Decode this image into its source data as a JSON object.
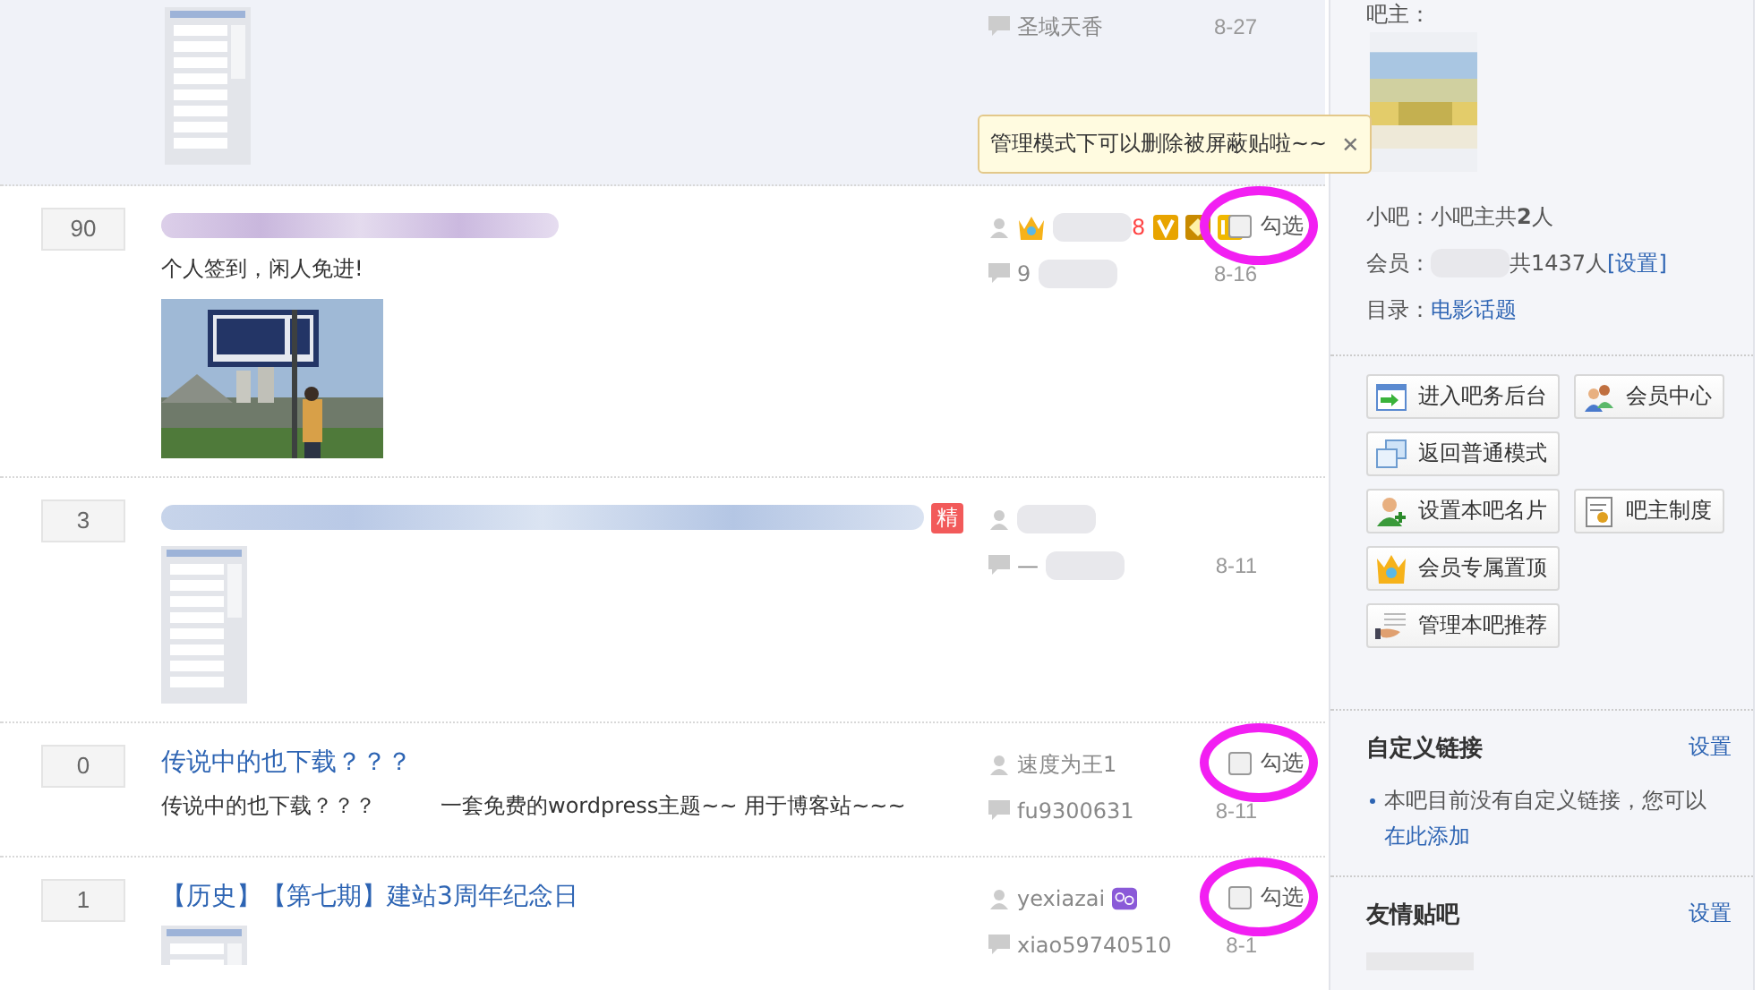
{
  "tooltip": {
    "text": "管理模式下可以删除被屏蔽贴啦~~",
    "close": "✕"
  },
  "threads": [
    {
      "shaded": true,
      "featured": false,
      "last_reply": {
        "kind": "text",
        "text": "圣域天香"
      },
      "date": "8-27"
    },
    {
      "shaded": false,
      "replies": "90",
      "title": {
        "kind": "blurred"
      },
      "featured": false,
      "excerpt": "个人签到，闲人免进!",
      "author": {
        "kind": "blurred",
        "text": "8",
        "vip": true
      },
      "last_reply": {
        "kind": "blurred",
        "text": "9"
      },
      "date": "8-16",
      "checkbox": {
        "label": "勾选",
        "checked": false,
        "circled": true
      }
    },
    {
      "shaded": false,
      "replies": "3",
      "title": {
        "kind": "blurred"
      },
      "featured": true,
      "featured_label": "精",
      "author": {
        "kind": "blurred",
        "vip": false
      },
      "last_reply": {
        "kind": "blurred",
        "text": "—"
      },
      "date": "8-11"
    },
    {
      "shaded": false,
      "replies": "0",
      "title": {
        "kind": "text",
        "text": "传说中的也下载？？？"
      },
      "featured": false,
      "excerpt": "传说中的也下载？？？　　　一套免费的wordpress主题~~ 用于博客站~~~",
      "author": {
        "kind": "text",
        "text": "速度为王1",
        "vip": false
      },
      "last_reply": {
        "kind": "text",
        "text": "fu9300631"
      },
      "date": "8-11",
      "checkbox": {
        "label": "勾选",
        "checked": false,
        "circled": true
      }
    },
    {
      "shaded": false,
      "replies": "1",
      "title": {
        "kind": "text",
        "text": "【历史】【第七期】建站3周年纪念日"
      },
      "featured": false,
      "author": {
        "kind": "text",
        "text": "yexiazai",
        "vip": false,
        "zodiac": true
      },
      "last_reply": {
        "kind": "text",
        "text": "xiao59740510"
      },
      "date": "8-1",
      "checkbox": {
        "label": "勾选",
        "checked": false,
        "circled": true
      }
    }
  ],
  "sidebar": {
    "owner_label": "吧主：",
    "info": [
      {
        "label": "小吧：",
        "value": "小吧主共**2**人",
        "kind": "plain"
      },
      {
        "label": "会员：",
        "value": "共1437人",
        "link": "[设置]",
        "kind": "members"
      },
      {
        "label": "目录：",
        "link": "电影话题",
        "kind": "link"
      }
    ],
    "buttons": [
      {
        "label": "进入吧务后台"
      },
      {
        "label": "会员中心"
      },
      {
        "label": "返回普通模式"
      },
      {
        "label": "设置本吧名片"
      },
      {
        "label": "吧主制度"
      },
      {
        "label": "会员专属置顶"
      },
      {
        "label": "管理本吧推荐"
      }
    ],
    "sections": [
      {
        "title": "自定义链接",
        "action": "设置",
        "text": "本吧目前没有自定义链接，您可以",
        "link": "在此添加"
      },
      {
        "title": "友情贴吧",
        "action": "设置"
      }
    ]
  }
}
